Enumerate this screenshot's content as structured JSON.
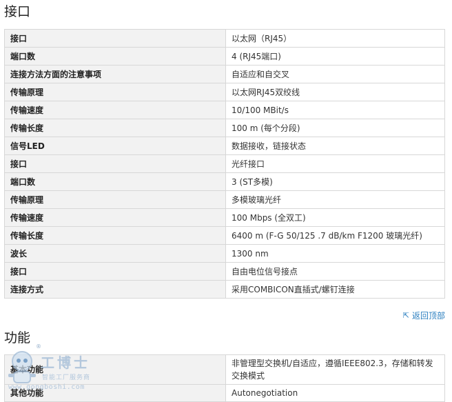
{
  "sections": {
    "interface": {
      "title": "接口",
      "rows": [
        {
          "key": "接口",
          "value": "以太网（RJ45）"
        },
        {
          "key": "端口数",
          "value": "4 (RJ45端口)"
        },
        {
          "key": "连接方法方面的注意事项",
          "value": "自适应和自交叉"
        },
        {
          "key": "传输原理",
          "value": "以太网RJ45双绞线"
        },
        {
          "key": "传输速度",
          "value": "10/100 MBit/s"
        },
        {
          "key": "传输长度",
          "value": "100 m (每个分段)"
        },
        {
          "key": "信号LED",
          "value": "数据接收，链接状态"
        },
        {
          "key": "接口",
          "value": "光纤接口"
        },
        {
          "key": "端口数",
          "value": "3 (ST多模)"
        },
        {
          "key": "传输原理",
          "value": "多模玻璃光纤"
        },
        {
          "key": "传输速度",
          "value": "100 Mbps (全双工)"
        },
        {
          "key": "传输长度",
          "value": "6400 m (F-G 50/125 .7 dB/km F1200 玻璃光纤)"
        },
        {
          "key": "波长",
          "value": "1300 nm"
        },
        {
          "key": "接口",
          "value": "自由电位信号接点"
        },
        {
          "key": "连接方式",
          "value": "采用COMBICON直插式/螺钉连接"
        }
      ]
    },
    "back_to_top": "返回顶部",
    "function": {
      "title": "功能",
      "rows": [
        {
          "key": "基本功能",
          "value": "非管理型交换机/自适应，遵循IEEE802.3，存储和转发交换模式"
        },
        {
          "key": "其他功能",
          "value": "Autonegotiation"
        }
      ]
    }
  },
  "watermark": {
    "title": "工博士",
    "registered": "®",
    "subtitle": "智能工厂服务商",
    "url": "www.gongboshi.com"
  }
}
